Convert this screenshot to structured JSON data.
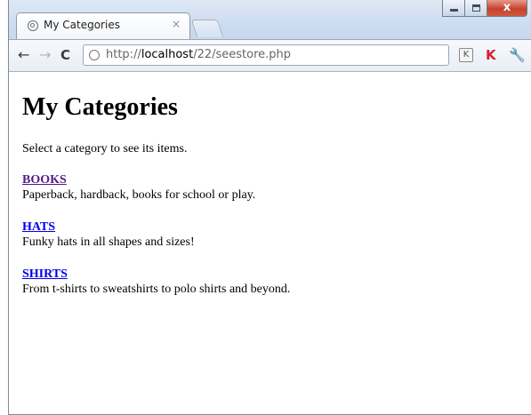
{
  "tab": {
    "title": "My Categories",
    "close": "×"
  },
  "toolbar": {
    "back": "←",
    "forward": "→",
    "reload": "C",
    "url_prefix": "http://",
    "url_host": "localhost",
    "url_path": "/22/seestore.php",
    "ext_k": "K",
    "ext_red": "K",
    "wrench": "🔧"
  },
  "window": {
    "close": "x"
  },
  "page": {
    "heading": "My Categories",
    "intro": "Select a category to see its items.",
    "categories": [
      {
        "name": "BOOKS",
        "description": "Paperback, hardback, books for school or play.",
        "visited": true
      },
      {
        "name": "HATS",
        "description": "Funky hats in all shapes and sizes!",
        "visited": false
      },
      {
        "name": "SHIRTS",
        "description": "From t-shirts to sweatshirts to polo shirts and beyond.",
        "visited": false
      }
    ]
  },
  "colors": {
    "link": "#0000ee",
    "visited_link": "#551a8b",
    "close_button": "#c7432d"
  }
}
